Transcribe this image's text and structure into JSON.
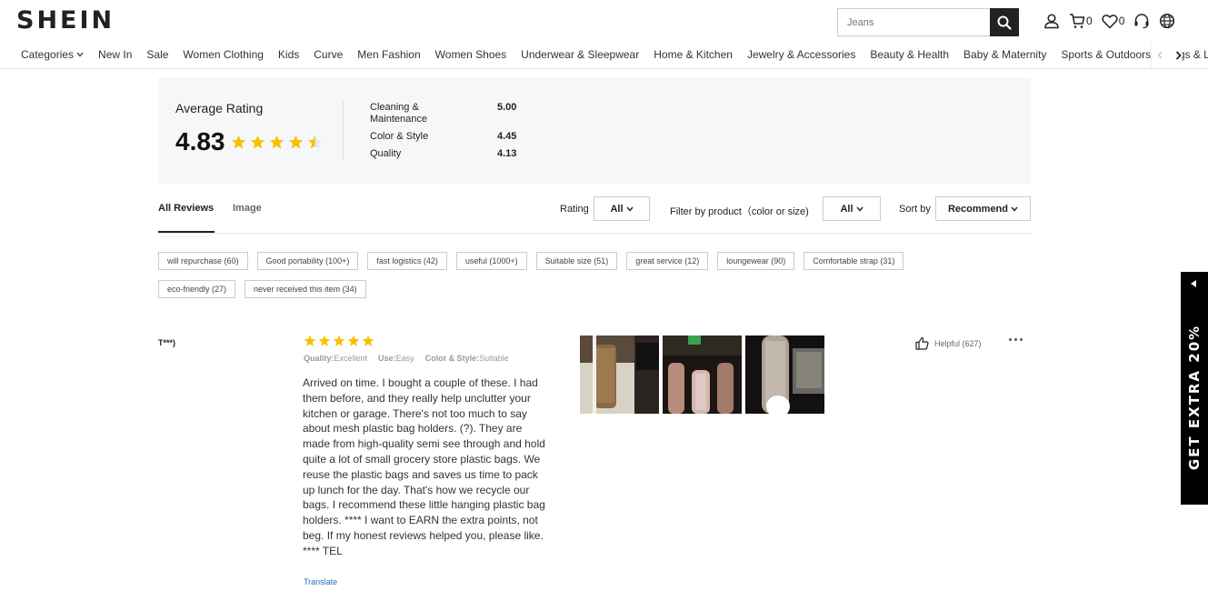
{
  "header": {
    "logo": "SHEIN",
    "search": {
      "placeholder": "Jeans"
    },
    "cart_count": "0",
    "wishlist_count": "0"
  },
  "nav": {
    "items": [
      "Categories",
      "New In",
      "Sale",
      "Women Clothing",
      "Kids",
      "Curve",
      "Men Fashion",
      "Women Shoes",
      "Underwear & Sleepwear",
      "Home & Kitchen",
      "Jewelry & Accessories",
      "Beauty & Health",
      "Baby & Maternity",
      "Sports & Outdoors",
      "Bags & Luggage"
    ]
  },
  "summary": {
    "avg_label": "Average Rating",
    "avg_value": "4.83",
    "avg_stars": 4.83,
    "metrics": [
      {
        "name": "Cleaning & Maintenance",
        "value": "5.00"
      },
      {
        "name": "Color & Style",
        "value": "4.45"
      },
      {
        "name": "Quality",
        "value": "4.13"
      }
    ]
  },
  "tabs": {
    "all_reviews": "All Reviews",
    "image": "Image"
  },
  "filters": {
    "rating_label": "Rating",
    "rating_value": "All",
    "product_label": "Filter by product（color or size)",
    "product_value": "All",
    "sort_label": "Sort by",
    "sort_value": "Recommend"
  },
  "tags": [
    "will repurchase (60)",
    "Good portability (100+)",
    "fast logistics (42)",
    "useful (1000+)",
    "Suitable size (51)",
    "great service (12)",
    "loungewear (90)",
    "Comfortable strap (31)",
    "eco-friendly (27)",
    "never received this item (34)"
  ],
  "review": {
    "reviewer": "T***)",
    "stars": 5,
    "attrs": [
      {
        "name": "Quality:",
        "value": "Excellent"
      },
      {
        "name": "Use:",
        "value": "Easy"
      },
      {
        "name": "Color & Style:",
        "value": "Suitable"
      }
    ],
    "text": "Arrived on time. I bought a couple of these. I had them before, and they really help unclutter your kitchen or garage. There's not too much to say about mesh plastic bag holders. (?). They are made from high-quality semi see through and hold quite a lot of small grocery store plastic bags. We reuse the plastic bags and saves us time to pack up lunch for the day. That's how we recycle our bags. I recommend these little hanging plastic bag holders. **** I want to EARN the extra points, not beg. If my honest reviews helped you, please like. **** TEL",
    "translate": "Translate",
    "helpful": "Helpful (627)",
    "photo_count": 3
  },
  "promo": {
    "text": "GET EXTRA 20%"
  },
  "colors": {
    "star": "#f8c100",
    "text": "#222222",
    "link": "#2a6fb8",
    "summary_bg": "#f6f7f8"
  }
}
